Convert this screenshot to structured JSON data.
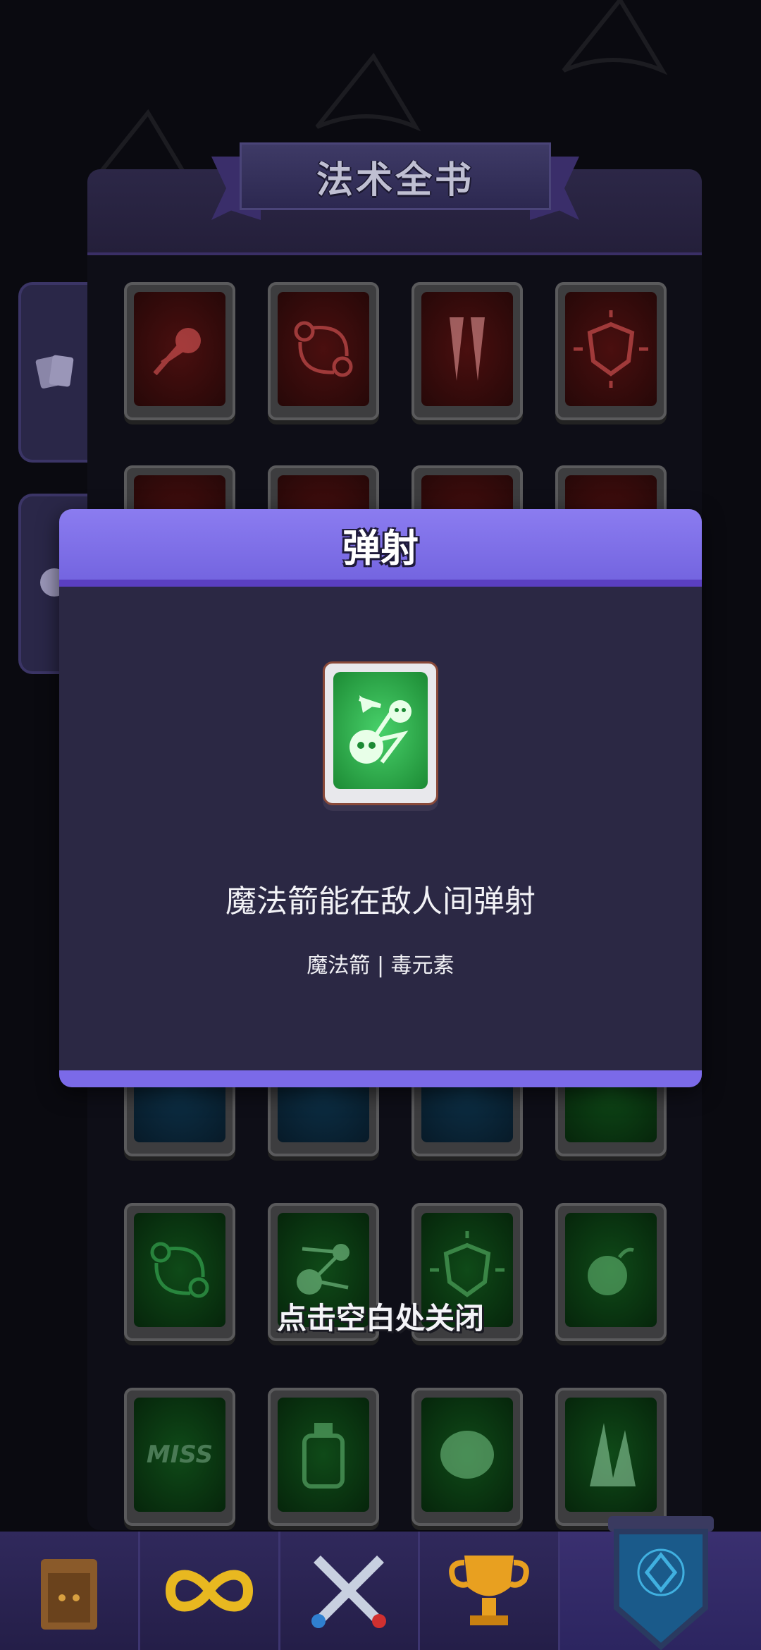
{
  "book": {
    "title": "法术全书"
  },
  "modal": {
    "title": "弹射",
    "icon": "ricochet-skull-icon",
    "description": "魔法箭能在敌人间弹射",
    "tags": "魔法箭 | 毒元素"
  },
  "hint": {
    "close_text": "点击空白处关闭"
  },
  "cards": {
    "row1": [
      "fireball-icon",
      "orbit-icon",
      "fang-icon",
      "fire-shield-icon"
    ],
    "row5": [
      "green-orbit-icon",
      "ricochet-icon",
      "poison-shield-icon",
      "bomb-icon"
    ],
    "row6": [
      "miss-icon",
      "poison-bottle-icon",
      "sheep-icon",
      "spikes-icon"
    ],
    "miss_label": "MISS"
  },
  "nav": {
    "items": [
      "chest-icon",
      "infinity-icon",
      "swords-icon",
      "trophy-icon",
      "spellbook-shield-icon"
    ]
  },
  "colors": {
    "modal_header": "#8b7cf0",
    "modal_bg": "#2b2844",
    "card_green": "#2fb050",
    "card_red": "#4a0f0f",
    "card_blue": "#0d3148"
  }
}
